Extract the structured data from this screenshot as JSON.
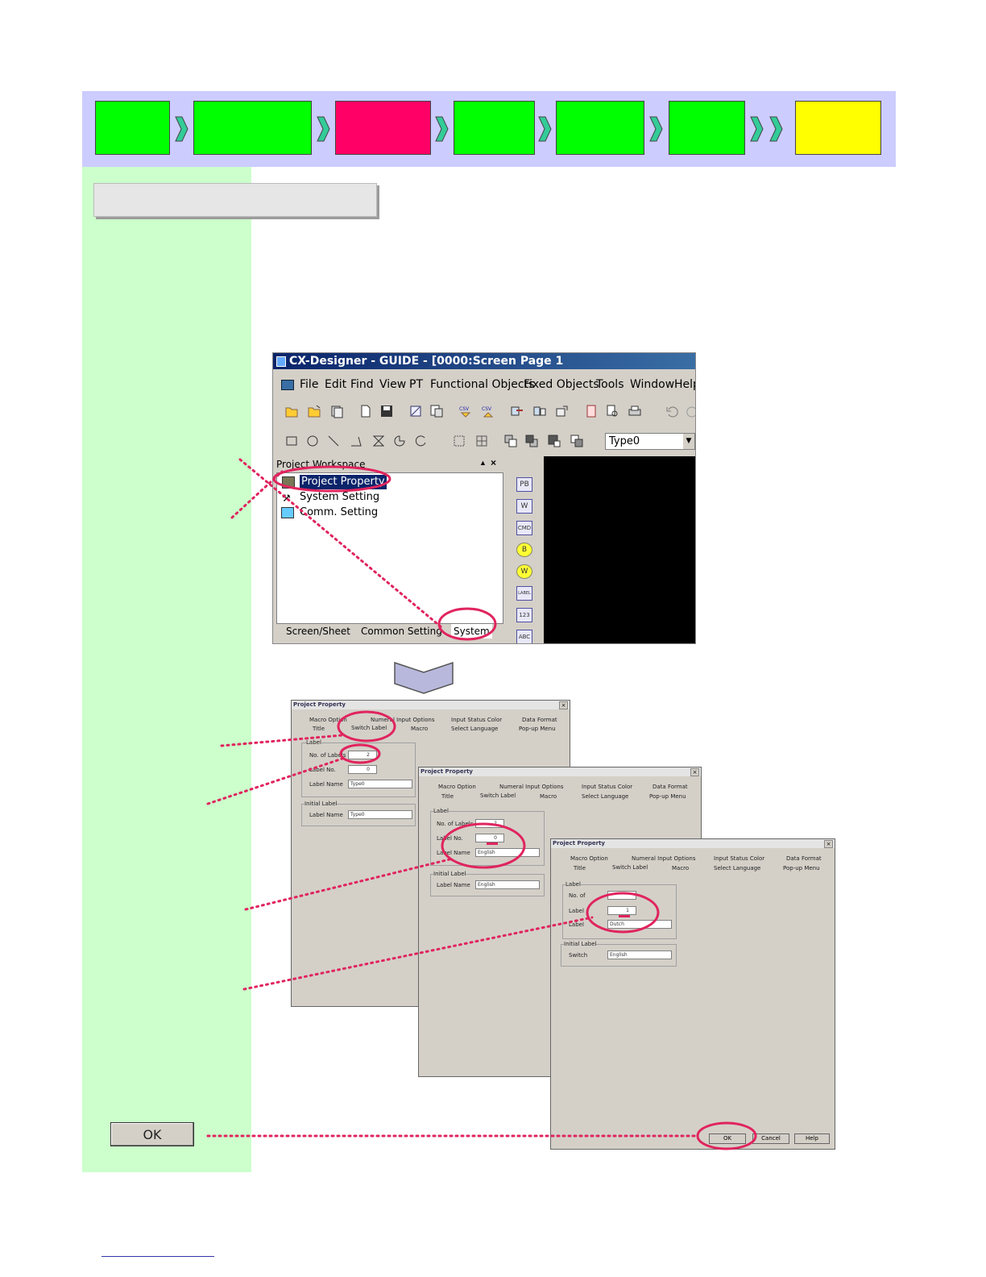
{
  "flow_steps": [
    {
      "color": "#00ff00"
    },
    {
      "color": "#00ff00"
    },
    {
      "color": "#ff0066"
    },
    {
      "color": "#00ff00"
    },
    {
      "color": "#00ff00"
    },
    {
      "color": "#00ff00"
    },
    {
      "color": "#ffff00"
    }
  ],
  "colors": {
    "band": "#ccccff",
    "sidebar": "#ccffcc",
    "highlight": "#e0245e"
  },
  "app": {
    "title": "CX-Designer - GUIDE - [0000:Screen Page 1",
    "menu": [
      "File",
      "Edit",
      "Find",
      "View",
      "PT",
      "Functional Objects",
      "Fixed Objects",
      "Tools",
      "Window",
      "Help"
    ],
    "type_select": "Type0",
    "workspace_title": "Project Workspace",
    "tree": [
      "Project Property",
      "System Setting",
      "Comm. Setting"
    ],
    "tabs": [
      "Screen/Sheet",
      "Common Setting",
      "System"
    ],
    "side_tools": [
      "PB",
      "W",
      "CMD",
      "B",
      "W",
      "LABEL",
      "123",
      "ABC"
    ]
  },
  "dialogs": [
    {
      "title": "Project Property",
      "tabs_row1": [
        "Macro Option",
        "Numeral Input Options",
        "Input Status Color",
        "Data Format"
      ],
      "tabs_row2": [
        "Title",
        "Switch Label",
        "Macro",
        "Select Language",
        "Pop-up Menu"
      ],
      "group_label": "Label",
      "fields": [
        {
          "label": "No. of Labels",
          "value": "2"
        },
        {
          "label": "Label No.",
          "value": "0"
        },
        {
          "label": "Label Name",
          "value": "Type0"
        }
      ],
      "initial_group": "Initial Label",
      "initial_label": "Label Name",
      "initial_value": "Type0"
    },
    {
      "title": "Project Property",
      "tabs_row1": [
        "Macro Option",
        "Numeral Input Options",
        "Input Status Color",
        "Data Format"
      ],
      "tabs_row2": [
        "Title",
        "Switch Label",
        "Macro",
        "Select Language",
        "Pop-up Menu"
      ],
      "group_label": "Label",
      "fields": [
        {
          "label": "No. of Labels",
          "value": "2"
        },
        {
          "label": "Label No.",
          "value": "0"
        },
        {
          "label": "Label Name",
          "value": "English"
        }
      ],
      "initial_group": "Initial Label",
      "initial_label": "Label Name",
      "initial_value": "English"
    },
    {
      "title": "Project Property",
      "tabs_row1": [
        "Macro Option",
        "Numeral Input Options",
        "Input Status Color",
        "Data Format"
      ],
      "tabs_row2": [
        "Title",
        "Switch Label",
        "Macro",
        "Select Language",
        "Pop-up Menu"
      ],
      "group_label": "Label",
      "fields": [
        {
          "label": "No. of",
          "value": ""
        },
        {
          "label": "Label",
          "value": "1"
        },
        {
          "label": "Label",
          "value": "Dutch"
        }
      ],
      "initial_group": "Initial Label",
      "initial_label": "Switch",
      "initial_value": "English",
      "buttons": [
        "OK",
        "Cancel",
        "Help"
      ]
    }
  ],
  "ok_button": "OK"
}
